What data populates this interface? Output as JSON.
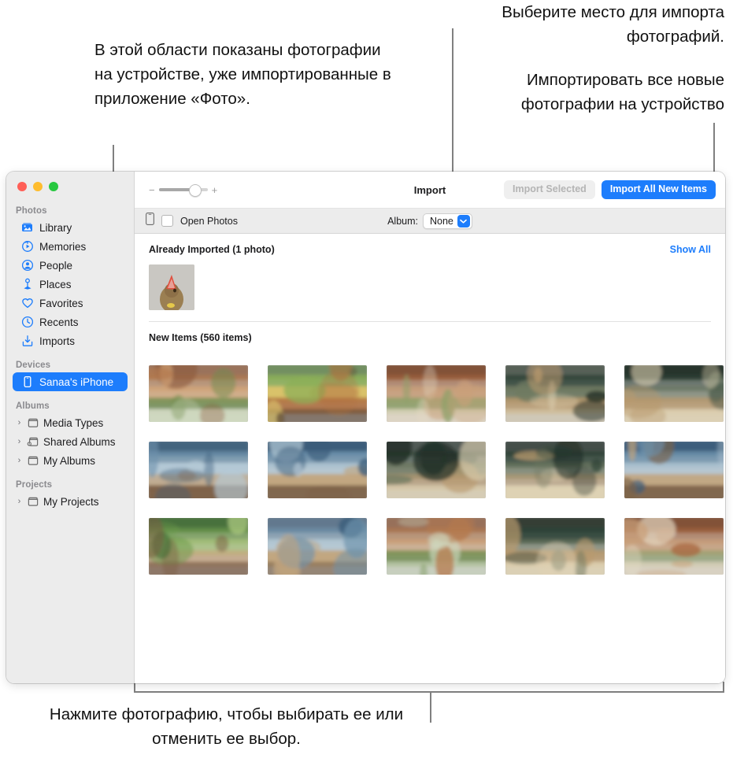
{
  "callouts": {
    "left": "В этой области показаны фотографии на устройстве, уже импортированные в приложение «Фото».",
    "top_right_1": "Выберите место для импорта фотографий.",
    "top_right_2": "Импортировать все новые фотографии на устройство",
    "bottom": "Нажмите фотографию, чтобы выбирать ее или отменить ее выбор."
  },
  "window": {
    "traffic_lights": [
      "close",
      "minimize",
      "zoom"
    ],
    "colors": {
      "accent": "#1d7dfc",
      "sidebar_bg": "#ececec",
      "close": "#ff5f57",
      "minimize": "#febc2e",
      "zoom": "#28c840"
    }
  },
  "sidebar": {
    "sections": [
      {
        "header": "Photos",
        "items": [
          {
            "label": "Library",
            "icon": "library-icon",
            "selected": false,
            "disclosure": false
          },
          {
            "label": "Memories",
            "icon": "memories-icon",
            "selected": false,
            "disclosure": false
          },
          {
            "label": "People",
            "icon": "people-icon",
            "selected": false,
            "disclosure": false
          },
          {
            "label": "Places",
            "icon": "places-icon",
            "selected": false,
            "disclosure": false
          },
          {
            "label": "Favorites",
            "icon": "heart-icon",
            "selected": false,
            "disclosure": false
          },
          {
            "label": "Recents",
            "icon": "clock-icon",
            "selected": false,
            "disclosure": false
          },
          {
            "label": "Imports",
            "icon": "import-icon",
            "selected": false,
            "disclosure": false
          }
        ]
      },
      {
        "header": "Devices",
        "items": [
          {
            "label": "Sanaa's iPhone",
            "icon": "iphone-icon",
            "selected": true,
            "disclosure": false
          }
        ]
      },
      {
        "header": "Albums",
        "items": [
          {
            "label": "Media Types",
            "icon": "folder-icon",
            "selected": false,
            "disclosure": true
          },
          {
            "label": "Shared Albums",
            "icon": "shared-folder-icon",
            "selected": false,
            "disclosure": true
          },
          {
            "label": "My Albums",
            "icon": "folder-icon",
            "selected": false,
            "disclosure": true
          }
        ]
      },
      {
        "header": "Projects",
        "items": [
          {
            "label": "My Projects",
            "icon": "folder-icon",
            "selected": false,
            "disclosure": true
          }
        ]
      }
    ]
  },
  "toolbar": {
    "title": "Import",
    "zoom_minus": "−",
    "zoom_plus": "+",
    "zoom_value": 72,
    "import_selected_label": "Import Selected",
    "import_selected_enabled": false,
    "import_all_label": "Import All New Items",
    "import_all_enabled": true
  },
  "subbar": {
    "device_icon": "iphone-icon",
    "open_photos_label": "Open Photos",
    "open_photos_checked": false,
    "album_label": "Album:",
    "album_value": "None",
    "album_options": [
      "None"
    ]
  },
  "sections": {
    "already_imported": {
      "title": "Already Imported (1 photo)",
      "show_all_label": "Show All",
      "count": 1,
      "thumbnails": [
        {
          "alt": "dog-with-party-hat"
        }
      ]
    },
    "new_items": {
      "title": "New Items (560 items)",
      "count": 560,
      "thumbnails": [
        {
          "alt": "two-hikers-on-tropical-path"
        },
        {
          "alt": "man-at-cafe-chalkboard"
        },
        {
          "alt": "man-smiling-by-flowers"
        },
        {
          "alt": "woman-laughing-with-backpack"
        },
        {
          "alt": "two-women-laughing-outdoors"
        },
        {
          "alt": "group-of-four-at-temple"
        },
        {
          "alt": "three-friends-sitting-at-ruins"
        },
        {
          "alt": "woman-walking-at-temple-ruins"
        },
        {
          "alt": "two-people-watching-river-boat"
        },
        {
          "alt": "woman-in-temple-doorway"
        },
        {
          "alt": "travellers-in-stone-corridor"
        },
        {
          "alt": "woman-by-carved-elephant"
        },
        {
          "alt": "friends-relaxing-on-grass"
        },
        {
          "alt": "two-women-on-tuk-tuk"
        },
        {
          "alt": "friends-cheering-with-arms-up"
        }
      ]
    }
  }
}
